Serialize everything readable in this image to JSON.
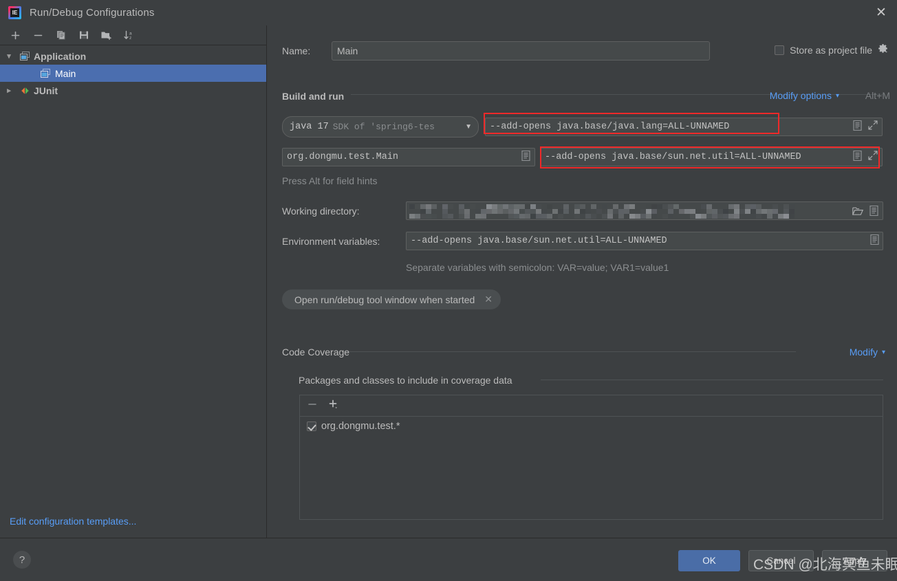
{
  "window": {
    "title": "Run/Debug Configurations",
    "app_icon": "intellij-idea-icon",
    "close_label": "✕"
  },
  "sidebar": {
    "toolbar": [
      {
        "name": "add-configuration-button",
        "icon": "plus-icon",
        "label": "+"
      },
      {
        "name": "remove-configuration-button",
        "icon": "minus-icon",
        "label": "−"
      },
      {
        "name": "copy-configuration-button",
        "icon": "copy-icon",
        "label": "Copy"
      },
      {
        "name": "save-configuration-button",
        "icon": "save-icon",
        "label": "Save"
      },
      {
        "name": "new-folder-button",
        "icon": "new-folder-icon",
        "label": "New Folder"
      },
      {
        "name": "sort-configurations-button",
        "icon": "sort-az-icon",
        "label": "Sort"
      }
    ],
    "tree": [
      {
        "label": "Application",
        "type": "group",
        "expanded": true,
        "icon": "application-icon"
      },
      {
        "label": "Main",
        "type": "child",
        "selected": true,
        "icon": "application-icon"
      },
      {
        "label": "JUnit",
        "type": "group",
        "expanded": false,
        "icon": "junit-icon"
      }
    ],
    "edit_templates_link": "Edit configuration templates..."
  },
  "form": {
    "name_label": "Name:",
    "name_value": "Main",
    "store_as_project_file_label": "Store as project file",
    "store_as_project_file_checked": false,
    "store_gear_icon": "gear-icon",
    "build_and_run_title": "Build and run",
    "modify_options_link": "Modify options",
    "modify_options_shortcut": "Alt+M",
    "jdk_main": "java 17",
    "jdk_sub": "SDK of 'spring6-tes",
    "vm_options_value": "--add-opens java.base/java.lang=ALL-UNNAMED",
    "main_class_value": "org.dongmu.test.Main",
    "program_arguments_value": "--add-opens java.base/sun.net.util=ALL-UNNAMED",
    "field_hint": "Press Alt for field hints",
    "working_directory_label": "Working directory:",
    "working_directory_value": "",
    "environment_variables_label": "Environment variables:",
    "environment_variables_value": "--add-opens java.base/sun.net.util=ALL-UNNAMED",
    "env_hint": "Separate variables with semicolon: VAR=value; VAR1=value1",
    "chip_label": "Open run/debug tool window when started",
    "chip_remove_icon": "close-icon"
  },
  "coverage": {
    "section_title": "Code Coverage",
    "modify_link": "Modify",
    "subsection_title": "Packages and classes to include in coverage data",
    "toolbar": [
      {
        "name": "remove-package-button",
        "icon": "minus-icon",
        "label": "−"
      },
      {
        "name": "add-package-button",
        "icon": "plus-dropdown-icon",
        "label": "+"
      }
    ],
    "items": [
      {
        "label": "org.dongmu.test.*",
        "checked": true
      }
    ]
  },
  "footer": {
    "help_label": "?",
    "ok_label": "OK",
    "cancel_label": "Cancel",
    "apply_label": "Apply"
  },
  "watermark": {
    "text": "CSDN @北海冥鱼未眠"
  },
  "annotations": {
    "highlight_1": "vm-options-field-highlight",
    "highlight_2": "program-arguments-field-highlight",
    "color": "#ef2929"
  }
}
